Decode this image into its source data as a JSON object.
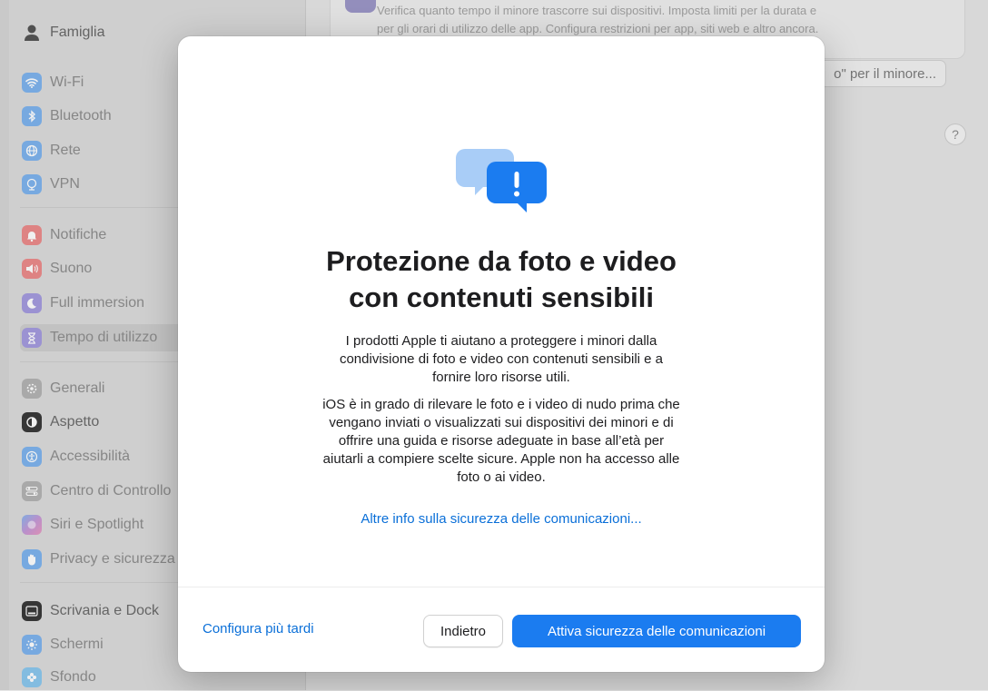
{
  "sidebar": {
    "items": [
      {
        "label": "Famiglia",
        "icon": "family-icon",
        "color": ""
      },
      {
        "label": "Wi-Fi",
        "icon": "wifi-icon",
        "color": "#7fb4ee"
      },
      {
        "label": "Bluetooth",
        "icon": "bluetooth-icon",
        "color": "#7fb4ee"
      },
      {
        "label": "Rete",
        "icon": "globe-icon",
        "color": "#7fb4ee"
      },
      {
        "label": "VPN",
        "icon": "vpn-icon",
        "color": "#7fb4ee"
      },
      {
        "label": "Notifiche",
        "icon": "bell-icon",
        "color": "#ec8c8c"
      },
      {
        "label": "Suono",
        "icon": "speaker-icon",
        "color": "#ec8c8c"
      },
      {
        "label": "Full immersion",
        "icon": "moon-icon",
        "color": "#a59ce0"
      },
      {
        "label": "Tempo di utilizzo",
        "icon": "hourglass-icon",
        "color": "#a59ce0"
      },
      {
        "label": "Generali",
        "icon": "gear-icon",
        "color": "#b4b4b4"
      },
      {
        "label": "Aspetto",
        "icon": "appearance-icon",
        "color": "#3a3a3a"
      },
      {
        "label": "Accessibilità",
        "icon": "accessibility-icon",
        "color": "#7fb4ee"
      },
      {
        "label": "Centro di Controllo",
        "icon": "control-center-icon",
        "color": "#b4b4b4"
      },
      {
        "label": "Siri e Spotlight",
        "icon": "siri-icon",
        "color": "#c59ad8"
      },
      {
        "label": "Privacy e sicurezza",
        "icon": "hand-icon",
        "color": "#7fb4ee"
      },
      {
        "label": "Scrivania e Dock",
        "icon": "dock-icon",
        "color": "#3a3a3a"
      },
      {
        "label": "Schermi",
        "icon": "sun-icon",
        "color": "#7fb4ee"
      },
      {
        "label": "Sfondo",
        "icon": "flower-icon",
        "color": "#8cc8ee"
      }
    ]
  },
  "background": {
    "description_line1": "Verifica quanto tempo il minore trascorre sui dispositivi. Imposta limiti per la durata e",
    "description_line2": "per gli orari di utilizzo delle app. Configura restrizioni per app, siti web e altro ancora.",
    "button_label": "o\" per il minore...",
    "help_label": "?"
  },
  "modal": {
    "title_line1": "Protezione da foto e video",
    "title_line2": "con contenuti sensibili",
    "para1_lines": [
      "I prodotti Apple ti aiutano a proteggere i minori dalla",
      "condivisione di foto e video con contenuti sensibili e a",
      "fornire loro risorse utili."
    ],
    "para2_lines": [
      "iOS è in grado di rilevare le foto e i video di nudo prima che",
      "vengano inviati o visualizzati sui dispositivi dei minori e di",
      "offrire una guida e risorse adeguate in base all’età per",
      "aiutarli a compiere scelte sicure. Apple non ha accesso alle",
      "foto o ai video."
    ],
    "learn_more_link": "Altre info sulla sicurezza delle comunicazioni...",
    "later_link": "Configura più tardi",
    "back_button": "Indietro",
    "primary_button": "Attiva sicurezza delle comunicazioni",
    "colors": {
      "accent": "#1b7cf0",
      "link": "#0a6fd8",
      "icon_back": "#a9cdf7",
      "icon_front": "#1b7cf0"
    }
  }
}
